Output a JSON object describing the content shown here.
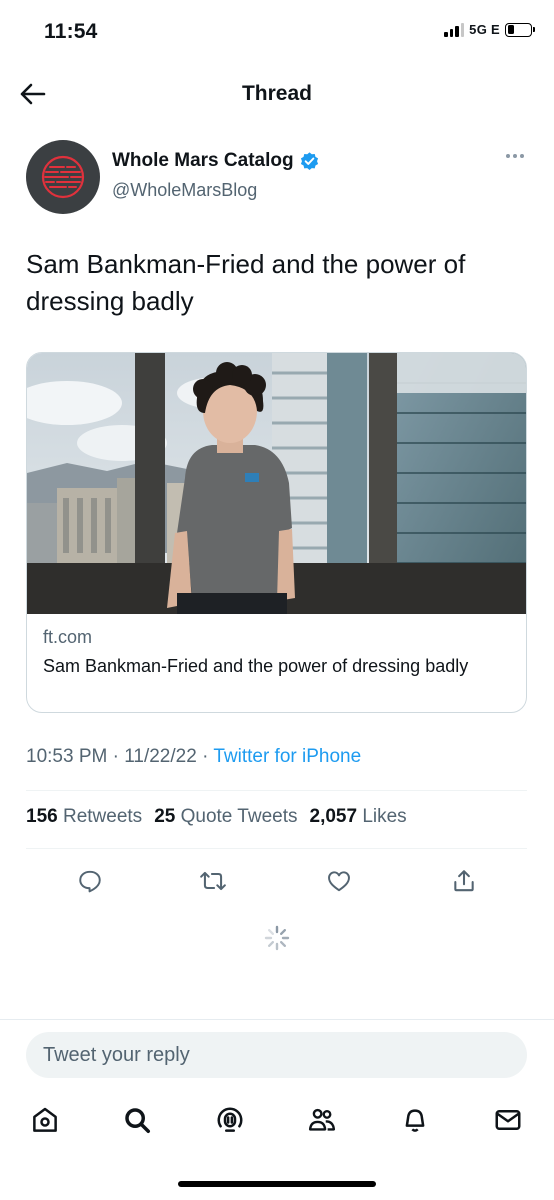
{
  "status_bar": {
    "time": "11:54",
    "network": "5G E"
  },
  "header": {
    "title": "Thread"
  },
  "tweet": {
    "author_name": "Whole Mars Catalog",
    "author_handle": "@WholeMarsBlog",
    "verified": true,
    "text": "Sam Bankman-Fried and the power of dressing badly",
    "time": "10:53 PM",
    "date": "11/22/22",
    "source": "Twitter for iPhone",
    "separator": "·"
  },
  "link_card": {
    "domain": "ft.com",
    "title": "Sam Bankman-Fried and the power of dressing badly"
  },
  "stats": {
    "retweets_count": "156",
    "retweets_label": "Retweets",
    "quotes_count": "25",
    "quotes_label": "Quote Tweets",
    "likes_count": "2,057",
    "likes_label": "Likes"
  },
  "actions": [
    "reply-icon",
    "retweet-icon",
    "like-icon",
    "share-icon"
  ],
  "reply": {
    "placeholder": "Tweet your reply"
  },
  "tabbar": [
    "home-icon",
    "search-icon",
    "spaces-icon",
    "communities-icon",
    "notifications-icon",
    "messages-icon"
  ],
  "colors": {
    "accent": "#1d9bf0",
    "secondary_text": "#536471",
    "divider": "#eff3f4"
  }
}
